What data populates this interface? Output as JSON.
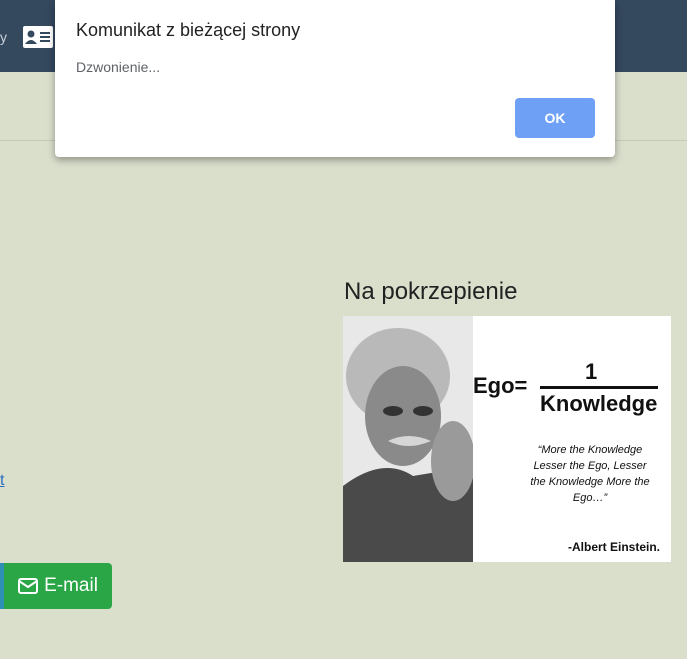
{
  "header": {
    "nav_fragment": "y",
    "contact_icon": "contact-card-icon"
  },
  "dialog": {
    "title": "Komunikat z bieżącej strony",
    "message": "Dzwonienie...",
    "ok_label": "OK"
  },
  "sidebar": {
    "heading": "Na pokrzepienie",
    "quote_image": {
      "ego_label": "Ego=",
      "numerator": "1",
      "denominator": "Knowledge",
      "quote": "“More the Knowledge Lesser the Ego, Lesser the Knowledge More the Ego…”",
      "author": "-Albert Einstein."
    }
  },
  "content": {
    "link_fragment": "t",
    "email_button_label": "E-mail",
    "email_icon": "envelope-icon"
  },
  "colors": {
    "header_bg": "#34485e",
    "page_bg": "#dadfcc",
    "ok_button": "#6ea0f5",
    "email_button": "#2aa646"
  }
}
